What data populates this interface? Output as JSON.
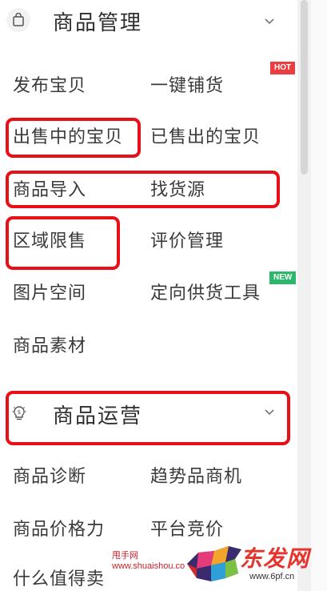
{
  "sections": [
    {
      "title": "商品管理",
      "icon": "shopping-bag-icon",
      "items": [
        {
          "label": "发布宝贝"
        },
        {
          "label": "一键铺货",
          "badge": "HOT"
        },
        {
          "label": "出售中的宝贝"
        },
        {
          "label": "已售出的宝贝"
        },
        {
          "label": "商品导入"
        },
        {
          "label": "找货源"
        },
        {
          "label": "区域限售"
        },
        {
          "label": "评价管理"
        },
        {
          "label": "图片空间"
        },
        {
          "label": "定向供货工具",
          "badge": "NEW"
        },
        {
          "label": "商品素材"
        }
      ]
    },
    {
      "title": "商品运营",
      "icon": "lightbulb-dollar-icon",
      "items": [
        {
          "label": "商品诊断"
        },
        {
          "label": "趋势品商机"
        },
        {
          "label": "商品价格力"
        },
        {
          "label": "平台竞价"
        },
        {
          "label": "什么值得卖"
        }
      ]
    }
  ],
  "watermark": {
    "site_name_small": "甩手网",
    "site_url_small": "www.shuaishou.co",
    "brand_text": "东发网",
    "brand_url": "www.6pf.cn"
  },
  "colors": {
    "annotation_red": "#e80f16",
    "hot_badge": "#ec3e40",
    "new_badge": "#2cb86a"
  }
}
